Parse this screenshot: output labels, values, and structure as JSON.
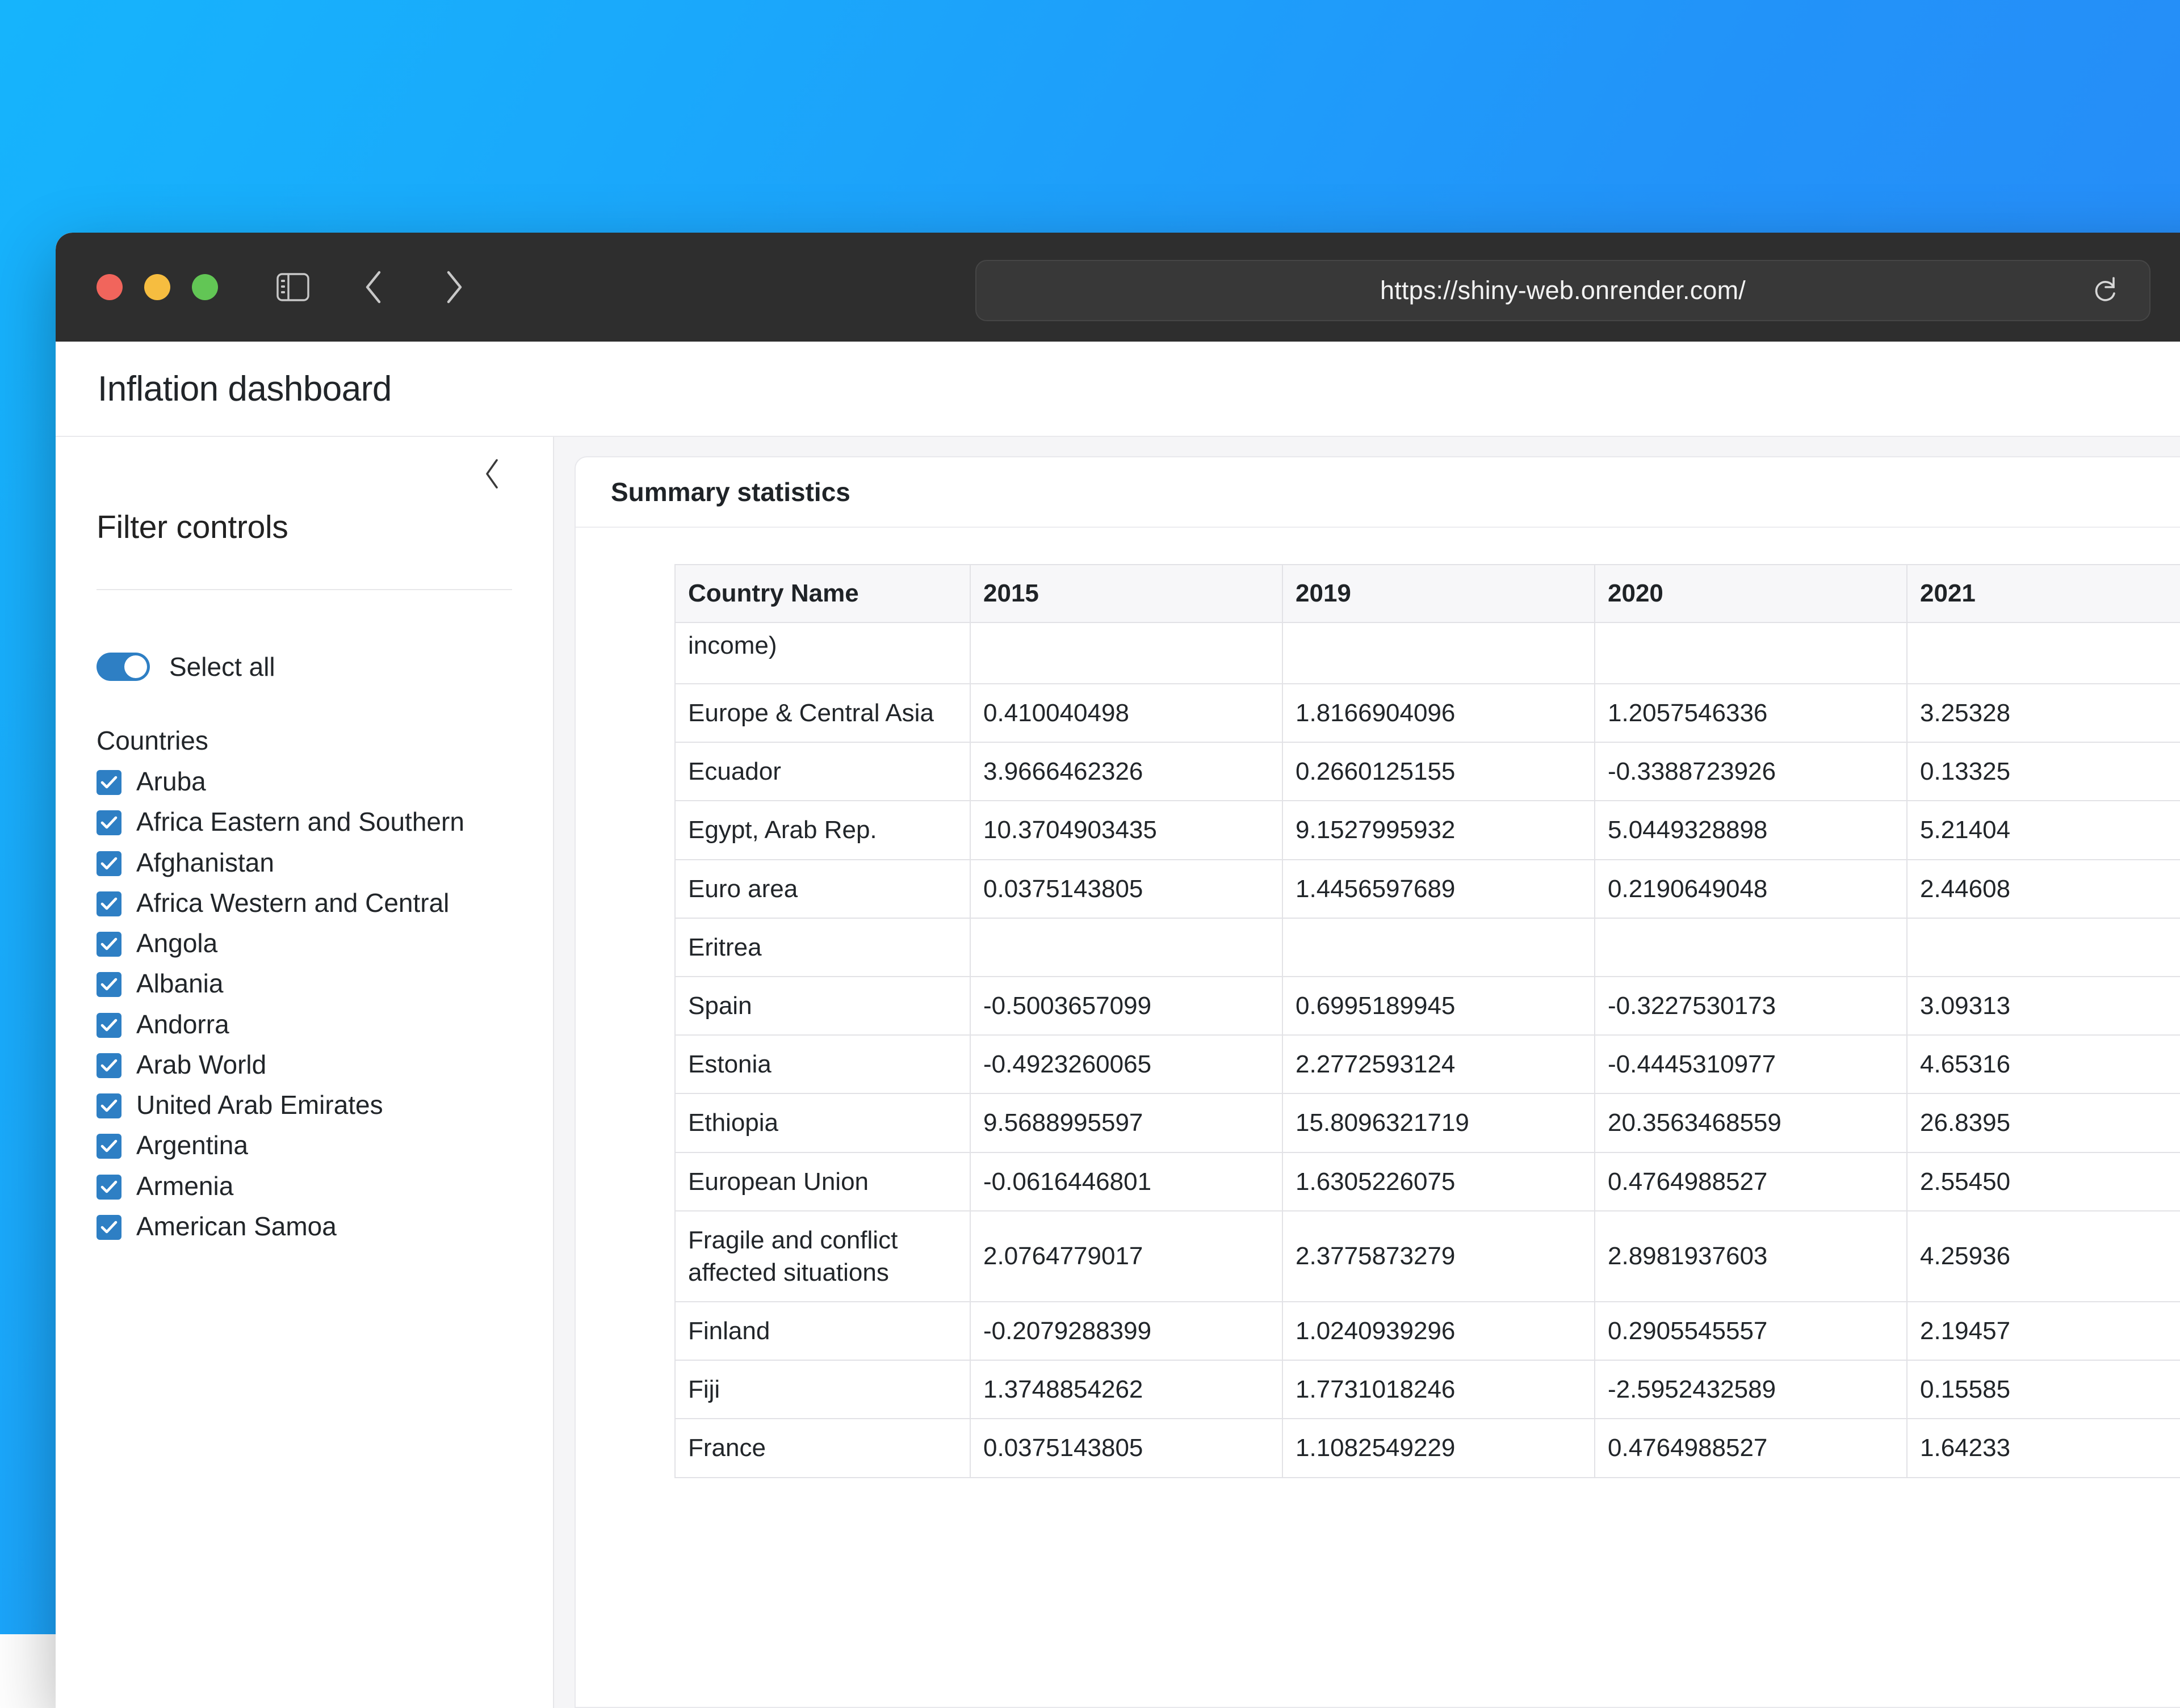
{
  "desktop": {
    "gradient_from": "#16b4fc",
    "gradient_to": "#2b86f7"
  },
  "browser": {
    "traffic_lights": {
      "close_color": "#f1655c",
      "minimize_color": "#f6bd40",
      "maximize_color": "#62c655"
    },
    "sidebar_toggle_icon": "sidebar-panel-icon",
    "back_icon": "chevron-left-icon",
    "forward_icon": "chevron-right-icon",
    "url": "https://shiny-web.onrender.com/",
    "reload_icon": "reload-icon"
  },
  "app": {
    "title": "Inflation dashboard"
  },
  "sidebar": {
    "collapse_icon": "chevron-left-icon",
    "heading": "Filter controls",
    "select_all": {
      "label": "Select all",
      "checked": true,
      "accent": "#2e7fc4"
    },
    "countries_label": "Countries",
    "countries": [
      {
        "label": "Aruba",
        "checked": true
      },
      {
        "label": "Africa Eastern and Southern",
        "checked": true
      },
      {
        "label": "Afghanistan",
        "checked": true
      },
      {
        "label": "Africa Western and Central",
        "checked": true
      },
      {
        "label": "Angola",
        "checked": true
      },
      {
        "label": "Albania",
        "checked": true
      },
      {
        "label": "Andorra",
        "checked": true
      },
      {
        "label": "Arab World",
        "checked": true
      },
      {
        "label": "United Arab Emirates",
        "checked": true
      },
      {
        "label": "Argentina",
        "checked": true
      },
      {
        "label": "Armenia",
        "checked": true
      },
      {
        "label": "American Samoa",
        "checked": true
      }
    ]
  },
  "main": {
    "card_title": "Summary statistics"
  },
  "chart_data": {
    "type": "table",
    "title": "Summary statistics",
    "columns": [
      "Country Name",
      "2015",
      "2019",
      "2020",
      "2021"
    ],
    "note": "Inflation rate (annual %) by country / aggregate. Table is scrolled; first row is clipped and the 2021 column is cut off at the right edge of the viewport.",
    "clipped_first_row": {
      "name_visible_text": "income)",
      "values": [
        "",
        "",
        "",
        ""
      ]
    },
    "rows": [
      {
        "name": "Europe & Central Asia",
        "values": [
          "0.410040498",
          "1.8166904096",
          "1.2057546336",
          "3.25328"
        ]
      },
      {
        "name": "Ecuador",
        "values": [
          "3.9666462326",
          "0.2660125155",
          "-0.3388723926",
          "0.13325"
        ]
      },
      {
        "name": "Egypt, Arab Rep.",
        "values": [
          "10.3704903435",
          "9.1527995932",
          "5.0449328898",
          "5.21404"
        ]
      },
      {
        "name": "Euro area",
        "values": [
          "0.0375143805",
          "1.4456597689",
          "0.2190649048",
          "2.44608"
        ]
      },
      {
        "name": "Eritrea",
        "values": [
          "",
          "",
          "",
          ""
        ]
      },
      {
        "name": "Spain",
        "values": [
          "-0.5003657099",
          "0.6995189945",
          "-0.3227530173",
          "3.09313"
        ]
      },
      {
        "name": "Estonia",
        "values": [
          "-0.4923260065",
          "2.2772593124",
          "-0.4445310977",
          "4.65316"
        ]
      },
      {
        "name": "Ethiopia",
        "values": [
          "9.5688995597",
          "15.8096321719",
          "20.3563468559",
          "26.8395"
        ]
      },
      {
        "name": "European Union",
        "values": [
          "-0.0616446801",
          "1.6305226075",
          "0.4764988527",
          "2.55450"
        ]
      },
      {
        "name": "Fragile and conflict affected situations",
        "values": [
          "2.0764779017",
          "2.3775873279",
          "2.8981937603",
          "4.25936"
        ]
      },
      {
        "name": "Finland",
        "values": [
          "-0.2079288399",
          "1.0240939296",
          "0.2905545557",
          "2.19457"
        ]
      },
      {
        "name": "Fiji",
        "values": [
          "1.3748854262",
          "1.7731018246",
          "-2.5952432589",
          "0.15585"
        ]
      },
      {
        "name": "France",
        "values": [
          "0.0375143805",
          "1.1082549229",
          "0.4764988527",
          "1.64233"
        ]
      }
    ]
  }
}
